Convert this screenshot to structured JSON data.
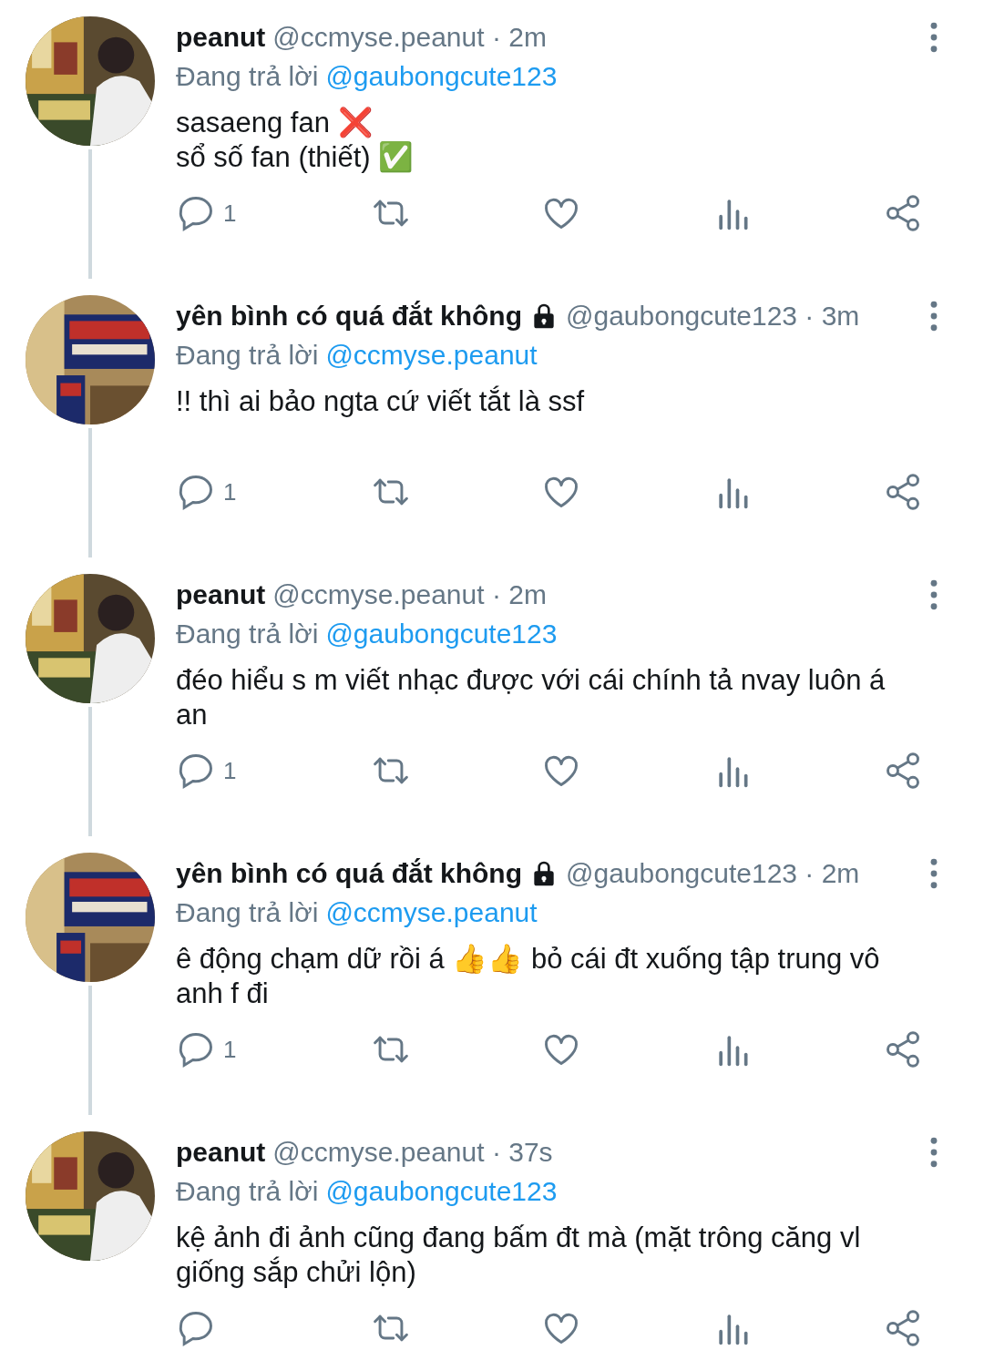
{
  "tweets": [
    {
      "name": "peanut",
      "locked": false,
      "meta": "@ccmyse.peanut · 2m",
      "reply_label": "Đang trả lời",
      "reply_to": "@gaubongcute123",
      "body": "sasaeng fan ❌\nsổ số fan (thiết) ✅",
      "reply_count": "1",
      "thread_line": true
    },
    {
      "name": "yên bình có quá đắt không",
      "locked": true,
      "meta": "@gaubongcute123 · 3m",
      "reply_label": "Đang trả lời",
      "reply_to": "@ccmyse.peanut",
      "body": "!! thì ai bảo ngta cứ viết tắt là ssf",
      "reply_count": "1",
      "thread_line": true
    },
    {
      "name": "peanut",
      "locked": false,
      "meta": "@ccmyse.peanut · 2m",
      "reply_label": "Đang trả lời",
      "reply_to": "@gaubongcute123",
      "body": "đéo hiểu s m viết nhạc được với cái chính tả nvay luôn á an",
      "reply_count": "1",
      "thread_line": true
    },
    {
      "name": "yên bình có quá đắt không",
      "locked": true,
      "meta": "@gaubongcute123 · 2m",
      "reply_label": "Đang trả lời",
      "reply_to": "@ccmyse.peanut",
      "body": "ê động chạm dữ rồi á 👍👍 bỏ cái đt xuống tập trung vô anh f đi",
      "reply_count": "1",
      "thread_line": true
    },
    {
      "name": "peanut",
      "locked": false,
      "meta": "@ccmyse.peanut · 37s",
      "reply_label": "Đang trả lời",
      "reply_to": "@gaubongcute123",
      "body": "kệ ảnh đi ảnh cũng đang bấm đt mà (mặt trông căng vl giống sắp chửi lộn)",
      "thread_line": false
    }
  ]
}
